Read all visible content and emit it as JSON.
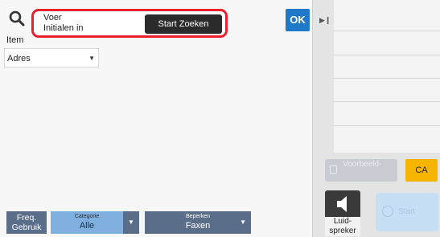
{
  "search": {
    "placeholder": "Voer\nInitialen in",
    "start_label": "Start Zoeken"
  },
  "ok_label": "OK",
  "item_label": "Item",
  "address_select": {
    "value": "Adres"
  },
  "bottom_bar": {
    "freq_label": "Freq.\nGebruik",
    "category_caption": "Categorie",
    "category_value": "Alle",
    "limit_caption": "Beperken",
    "limit_value": "Faxen"
  },
  "right_pane": {
    "preview_label": "Voorbeeld-",
    "ca_label": "CA",
    "speaker_label": "Luid-\nspreker",
    "start_label": "Start"
  },
  "colors": {
    "highlight": "#e8212d",
    "ok": "#1f78c8",
    "ca": "#f7b500"
  }
}
